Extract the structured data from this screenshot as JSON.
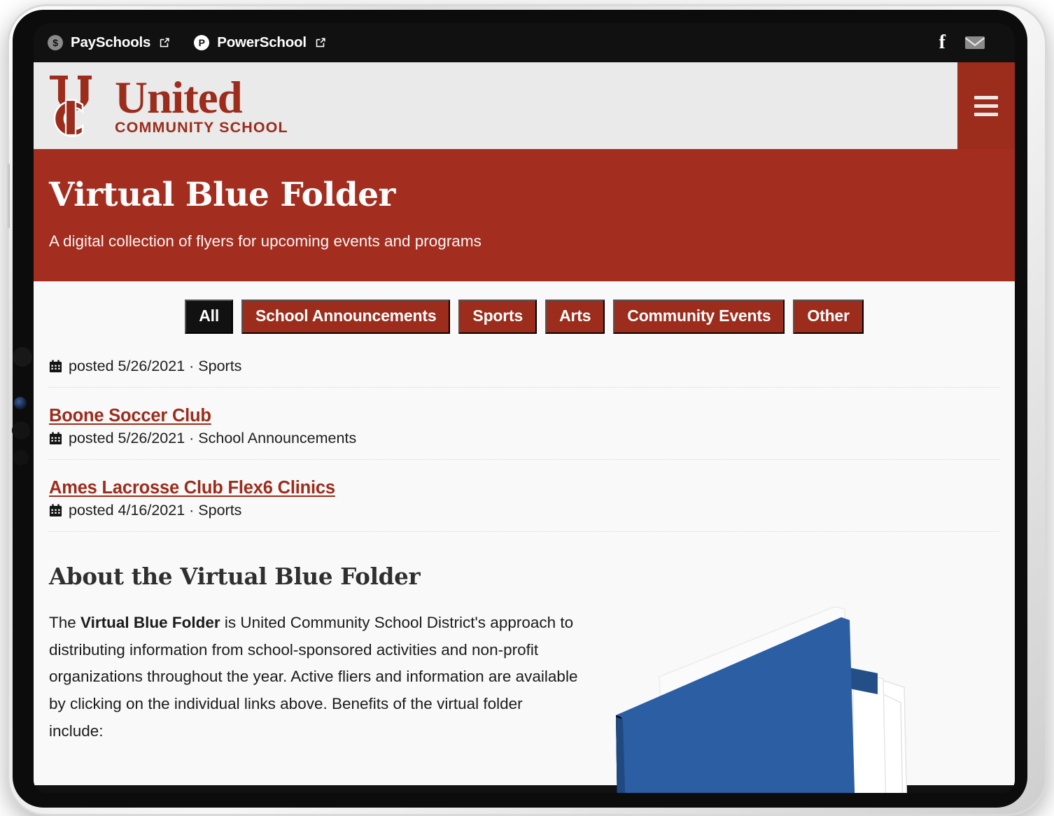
{
  "utility_bar": {
    "links": [
      {
        "label": "PaySchools",
        "icon": "dollar-circle-icon",
        "glyph": "$",
        "external": true
      },
      {
        "label": "PowerSchool",
        "icon": "powerschool-circle-icon",
        "glyph": "P",
        "external": true
      }
    ],
    "social": [
      {
        "name": "facebook-icon",
        "glyph": "f"
      },
      {
        "name": "email-icon",
        "glyph": "envelope"
      }
    ]
  },
  "site_header": {
    "logo_monogram": "UC",
    "wordmark_main": "United",
    "wordmark_sub": "COMMUNITY SCHOOL",
    "menu_label": "Menu"
  },
  "hero": {
    "title": "Virtual Blue Folder",
    "subtitle": "A digital collection of flyers for upcoming events and programs"
  },
  "filters": [
    {
      "label": "All",
      "active": true
    },
    {
      "label": "School Announcements",
      "active": false
    },
    {
      "label": "Sports",
      "active": false
    },
    {
      "label": "Arts",
      "active": false
    },
    {
      "label": "Community Events",
      "active": false
    },
    {
      "label": "Other",
      "active": false
    }
  ],
  "entries": [
    {
      "title": "",
      "meta": "posted 5/26/2021 · Sports"
    },
    {
      "title": "Boone Soccer Club",
      "meta": "posted 5/26/2021 · School Announcements"
    },
    {
      "title": "Ames Lacrosse Club Flex6 Clinics",
      "meta": "posted 4/16/2021 · Sports"
    }
  ],
  "about": {
    "heading": "About the Virtual Blue Folder",
    "para_lead": "The ",
    "para_bold": "Virtual Blue Folder",
    "para_rest": " is United Community School District's approach to distributing information from school-sponsored activities and non-profit organizations throughout the year. Active fliers and information are available by clicking on the individual links above. Benefits of the virtual folder include:"
  },
  "colors": {
    "brand_red": "#a32e1f",
    "logo_red": "#9c2c1c",
    "active_chip": "#111111",
    "folder_blue": "#2b5ea3",
    "page_bg": "#f9f9f9",
    "header_bg": "#eaeaea"
  }
}
